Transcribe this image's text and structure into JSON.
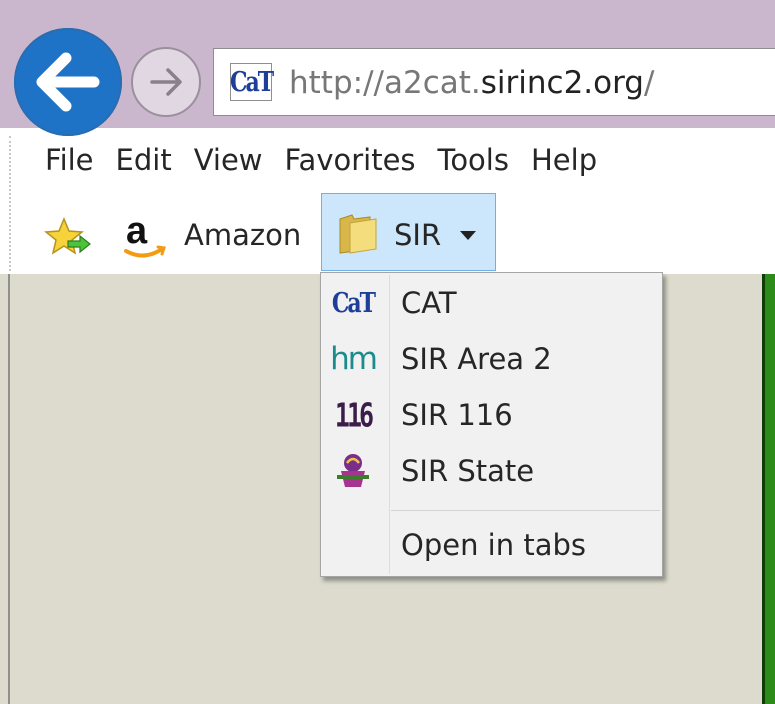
{
  "browser": {
    "address": {
      "site_icon_text": "CaT",
      "url_prefix": "http://a2cat.",
      "url_host": "sirinc2.org",
      "url_suffix": "/"
    },
    "back_icon": "back-arrow-icon",
    "forward_icon": "forward-arrow-icon"
  },
  "menubar": {
    "items": [
      "File",
      "Edit",
      "View",
      "Favorites",
      "Tools",
      "Help"
    ]
  },
  "favorites_bar": {
    "add_icon": "add-to-favorites-icon",
    "amazon": {
      "icon_text": "a",
      "label": "Amazon"
    },
    "folder": {
      "label": "SIR",
      "icon": "folder-icon"
    }
  },
  "dropdown": {
    "items": [
      {
        "label": "CAT",
        "icon": "cat-site-icon",
        "icon_text": "CaT"
      },
      {
        "label": "SIR Area 2",
        "icon": "hm-site-icon",
        "icon_text": "hm"
      },
      {
        "label": "SIR 116",
        "icon": "sir116-site-icon",
        "icon_text": "116"
      },
      {
        "label": "SIR State",
        "icon": "sir-state-site-icon"
      }
    ],
    "open_in_tabs": "Open in tabs"
  },
  "colors": {
    "titlebar": "#cab7cd",
    "back_button": "#1f73c6",
    "folder_highlight": "#cce6fb",
    "page_background": "#dcdbcd",
    "page_right_panel": "#2d8c19"
  }
}
